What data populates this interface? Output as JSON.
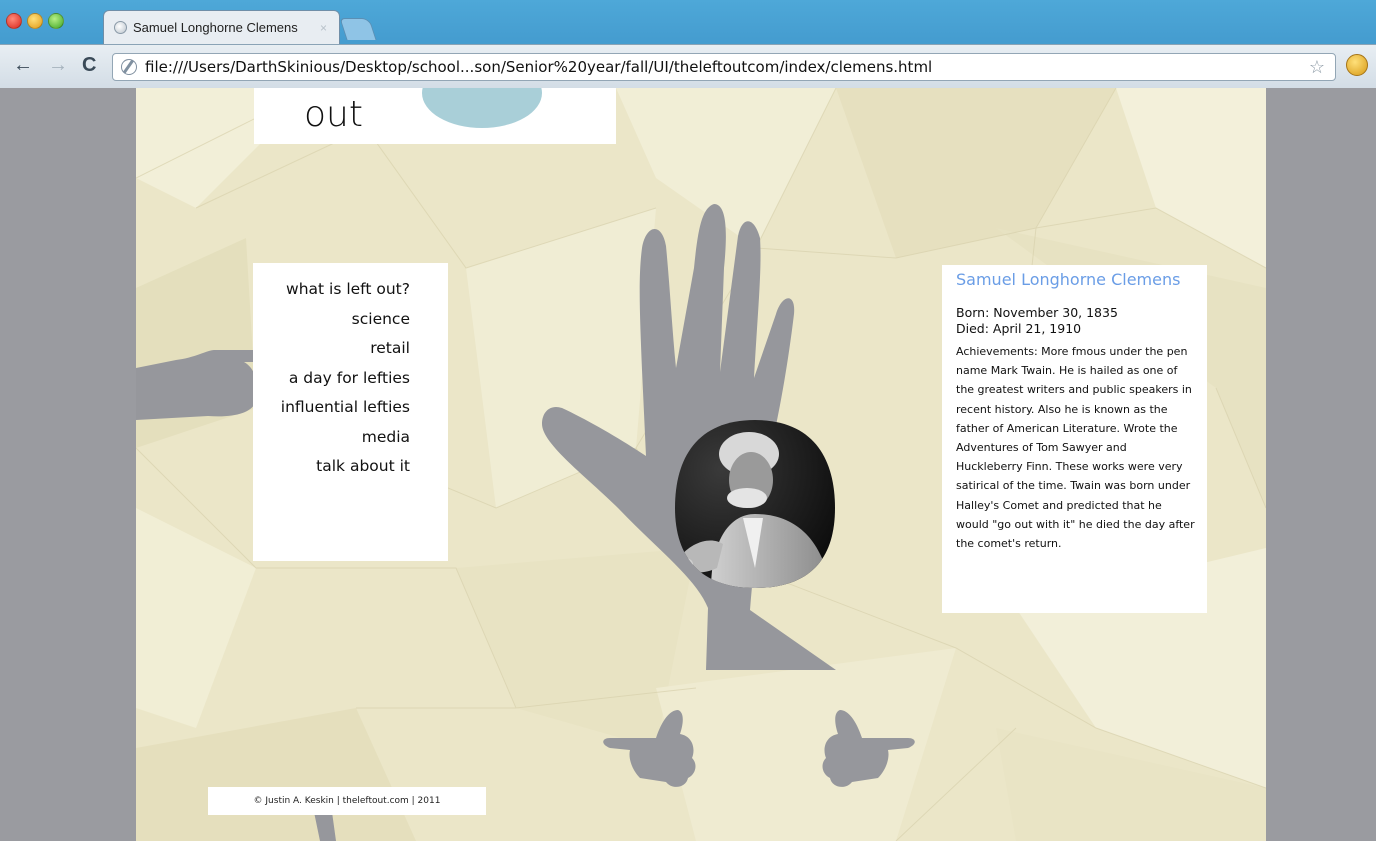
{
  "browser": {
    "tab_title": "Samuel Longhorne Clemens",
    "tab_close": "×",
    "url": "file:///Users/DarthSkinious/Desktop/school...son/Senior%20year/fall/UI/theleftoutcom/index/clemens.html",
    "back": "←",
    "forward": "→",
    "reload": "C",
    "bookmark_star": "☆"
  },
  "logo": {
    "line2": "out"
  },
  "nav": {
    "items": [
      "what is left out?",
      "science",
      "retail",
      "a day for lefties",
      "influential lefties",
      "media",
      "talk about it"
    ]
  },
  "profile": {
    "name": "Samuel Longhorne Clemens",
    "born": "Born: November 30, 1835",
    "died": "Died: April 21, 1910",
    "achievements": "Achievements: More fmous under the pen name Mark Twain. He is hailed as one of the greatest writers and public speakers in recent history. Also he is known as the father of American Literature. Wrote the Adventures of Tom Sawyer and Huckleberry Finn. These works were very satirical of the time. Twain was born under Halley's Comet and predicted that he would \"go out with it\" he died the day after the comet's return."
  },
  "footer": {
    "text": "© Justin A. Keskin | theleftout.com | 2011"
  },
  "colors": {
    "hand": "#96979c",
    "accent_title": "#6a9de6",
    "logo_blob": "#a9cfd8"
  }
}
